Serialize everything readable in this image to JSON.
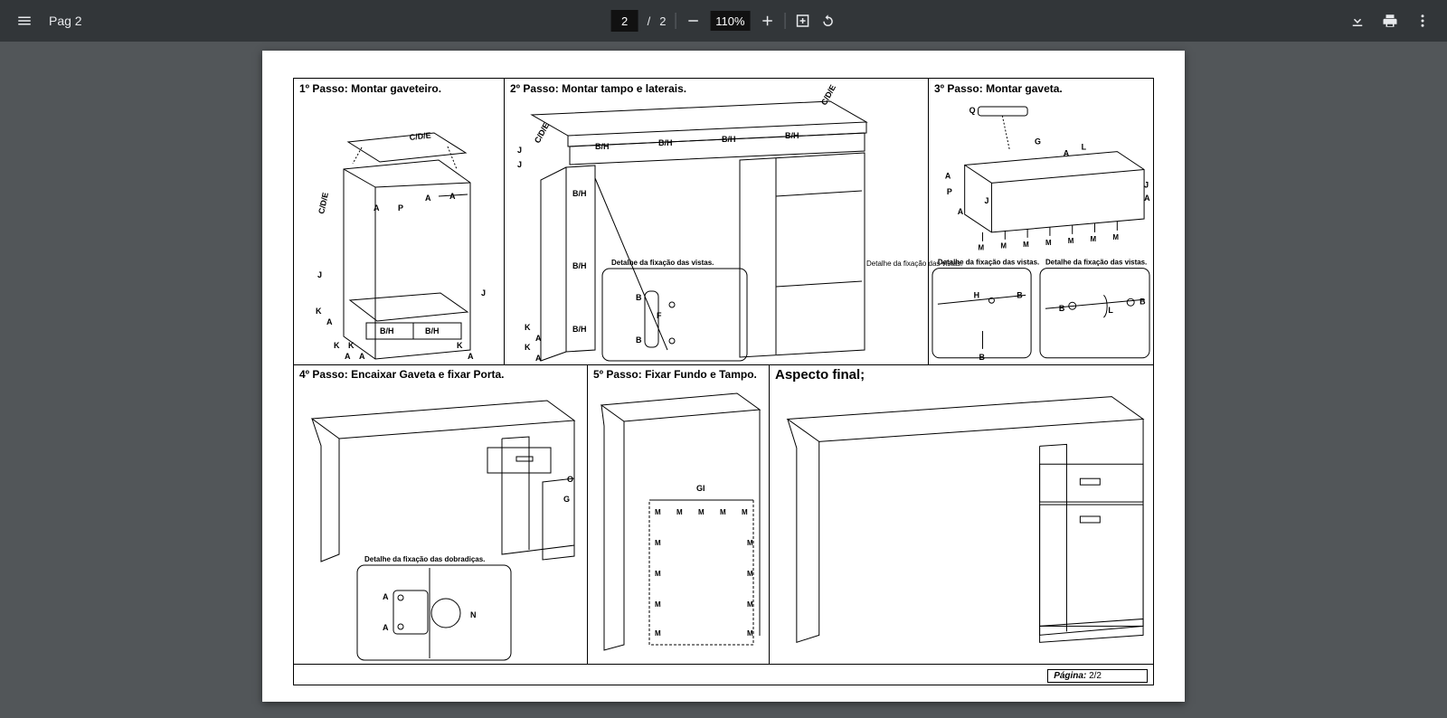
{
  "toolbar": {
    "title": "Pag 2",
    "page_current": "2",
    "page_total": "2",
    "page_sep": "/",
    "zoom": "110%"
  },
  "icons": {
    "menu": "menu-icon",
    "zoom_out": "minus-icon",
    "zoom_in": "plus-icon",
    "fit": "fit-page-icon",
    "rotate": "rotate-icon",
    "download": "download-icon",
    "print": "print-icon",
    "more": "more-vert-icon"
  },
  "doc": {
    "step1": {
      "title": "1º Passo: Montar gaveteiro."
    },
    "step2": {
      "title": "2º Passo: Montar tampo e laterais."
    },
    "step3": {
      "title": "3º Passo: Montar gaveta."
    },
    "step4": {
      "title": "4º Passo: Encaixar Gaveta e fixar Porta."
    },
    "step5": {
      "title": "5º Passo: Fixar Fundo e Tampo."
    },
    "final": {
      "title": "Aspecto final;"
    },
    "detail_views": "Detalhe da fixação das vistas.",
    "detail_hinges": "Detalhe da fixação das dobradiças.",
    "page_label_prefix": "Página:",
    "page_label_value": "2/2",
    "part_labels": {
      "A": "A",
      "B": "B",
      "C": "C",
      "D": "D",
      "E": "E",
      "F": "F",
      "G": "G",
      "H": "H",
      "J": "J",
      "K": "K",
      "L": "L",
      "M": "M",
      "N": "N",
      "O": "O",
      "P": "P",
      "Q": "Q",
      "BH": "B/H",
      "CDE": "C/D/E",
      "GI": "GI"
    }
  }
}
